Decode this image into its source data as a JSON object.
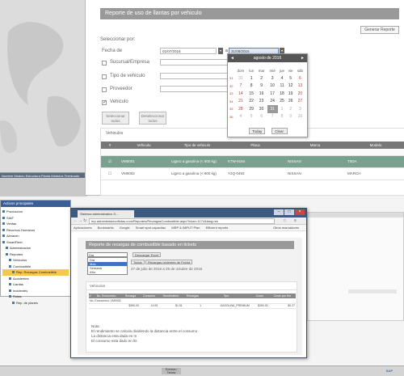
{
  "top": {
    "title": "Reporte de uso de llantas por vehiculo",
    "generate_btn": "Generar Reporte",
    "select_by": "Seleccionar por:",
    "date_label": "Fecha de",
    "date_from": "01/07/2016",
    "date_sep": "a",
    "date_to": "31/08/2016",
    "options": [
      {
        "label": "Sucursal/Empresa",
        "checked": false
      },
      {
        "label": "Tipo de vehiculo",
        "checked": false
      },
      {
        "label": "Proveedor",
        "checked": false
      },
      {
        "label": "Vehiculo",
        "checked": true
      }
    ],
    "select_all": "Seleccionar todos",
    "deselect_all": "Deseleccionar todos",
    "vehicles_caption": "Vehiculos",
    "table_headers": [
      "#",
      "Vehiculo",
      "Tipo de vehiculo",
      "Placa",
      "Marca",
      "Modelo"
    ],
    "rows": [
      {
        "vehiculo": "VM0001",
        "tipo": "Ligero a gasolina (< 800 kg)",
        "placa": "K7W-9184",
        "marca": "NISSAN",
        "modelo": "TIIDA",
        "selected": true
      },
      {
        "vehiculo": "VM0002",
        "tipo": "Ligero a gasolina (< 800 kg)",
        "placa": "Y2Q-0493",
        "marca": "NISSAN",
        "modelo": "MARCH",
        "selected": false
      }
    ]
  },
  "calendar": {
    "month": "agosto de 2016",
    "prev": "◄",
    "next": "►",
    "weekdays": [
      "dom",
      "lun",
      "mar",
      "mié",
      "jue",
      "vie",
      "sáb"
    ],
    "weeks": [
      [
        "31",
        "1",
        "2",
        "3",
        "4",
        "5",
        "6"
      ],
      [
        "7",
        "8",
        "9",
        "10",
        "11",
        "12",
        "13"
      ],
      [
        "14",
        "15",
        "16",
        "17",
        "18",
        "19",
        "20"
      ],
      [
        "21",
        "22",
        "23",
        "24",
        "25",
        "26",
        "27"
      ],
      [
        "28",
        "29",
        "30",
        "31",
        "1",
        "2",
        "3"
      ],
      [
        "4",
        "5",
        "6",
        "7",
        "8",
        "9",
        "10"
      ]
    ],
    "week_nums": [
      "31",
      "32",
      "33",
      "34",
      "35",
      "36"
    ],
    "today": "Today",
    "clear": "Clear"
  },
  "tree": {
    "title": "Activos principales",
    "items": [
      {
        "label": "Produccion",
        "indent": 0,
        "hl": false
      },
      {
        "label": "SIAF",
        "indent": 0,
        "hl": false
      },
      {
        "label": "Ventas",
        "indent": 0,
        "hl": false
      },
      {
        "label": "Recursos Humanos",
        "indent": 0,
        "hl": false
      },
      {
        "label": "Almacen",
        "indent": 0,
        "hl": false
      },
      {
        "label": "SmartFleet",
        "indent": 0,
        "hl": false
      },
      {
        "label": "Administracion",
        "indent": 1,
        "hl": false
      },
      {
        "label": "Reportes",
        "indent": 1,
        "hl": false
      },
      {
        "label": "Vehiculos",
        "indent": 2,
        "hl": false
      },
      {
        "label": "Combustible",
        "indent": 2,
        "hl": false
      },
      {
        "label": "Rep. Recargas Combustible",
        "indent": 3,
        "hl": true
      },
      {
        "label": "Accidentes",
        "indent": 2,
        "hl": false
      },
      {
        "label": "Llantas",
        "indent": 2,
        "hl": false
      },
      {
        "label": "Incidentes",
        "indent": 2,
        "hl": false
      },
      {
        "label": "Rutas",
        "indent": 2,
        "hl": false
      },
      {
        "label": "Rep. de planes",
        "indent": 3,
        "hl": false
      }
    ]
  },
  "browser": {
    "tab": "Sistema administrativo S...",
    "address": "erp.administracionflotas.com/Reportes/RecargasCombustible.aspx?idusr=1174&lang=es",
    "bookmarks": [
      "Aplicaciones",
      "Bookmarks",
      "Google",
      "Smart spot capacitac",
      "MRP & IMPUT Plan",
      "Efficient reports",
      "Otros marcadores"
    ],
    "title": "Reporte de recargas de combustible basado en tickets",
    "select_value": "Dia",
    "select_options": [
      "Dia",
      "Mes",
      "Semana",
      "Año"
    ],
    "select_selected": 1,
    "btn_export": "Descargar Excel",
    "btn_all": "Todos",
    "btn_recharge": "Recargas recientes de Fecha",
    "period": "27 de julio de 2016 a 29 de octubre de 2016",
    "caption": "Vehiculos",
    "table_headers": [
      "#",
      "No. Economico",
      "Recarga",
      "Consumo",
      "Rendimiento",
      "Recargas",
      "Tipo",
      "Costo",
      "Costo por Km"
    ],
    "group_row": "No. Economico: VM0002",
    "row": [
      "",
      "",
      "$390.00",
      "14.05",
      "$1.51",
      "1",
      "GASOLINA_PREMIUM",
      "$390.00",
      "$0.27"
    ],
    "notes": [
      "Nota:",
      "El rendimiento se calcula dividiendo la distancia entre el consumo",
      "La distancia esta dada en m",
      "El consumo esta dado en lts"
    ]
  },
  "strip": {
    "bar": "Nombre  Módulo  Estructura  Planta  Módulos  Terminado"
  },
  "taskbar": {
    "center": "Eventos / Tareas",
    "logo": "SAP"
  }
}
